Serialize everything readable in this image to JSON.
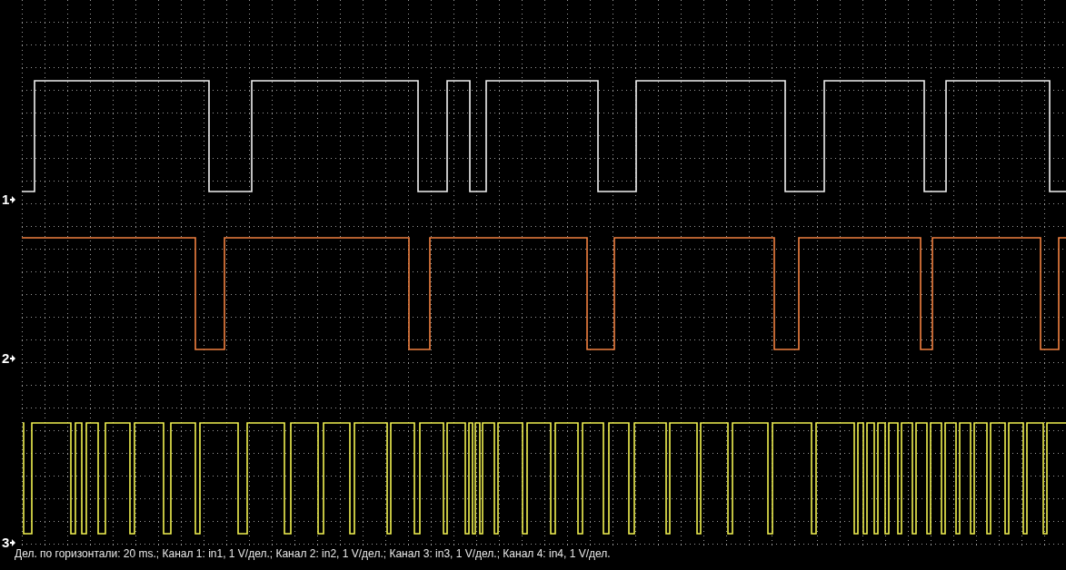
{
  "channels": [
    {
      "label": "1",
      "color": "#f0f0f0"
    },
    {
      "label": "2",
      "color": "#f08040"
    },
    {
      "label": "3",
      "color": "#f0f050"
    }
  ],
  "status_bar": "Дел. по горизонтали: 20 ms.; Канал 1: in1, 1 V/дел.; Канал 2: in2, 1 V/дел.; Канал 3: in3, 1 V/дел.; Канал 4: in4, 1 V/дел."
}
